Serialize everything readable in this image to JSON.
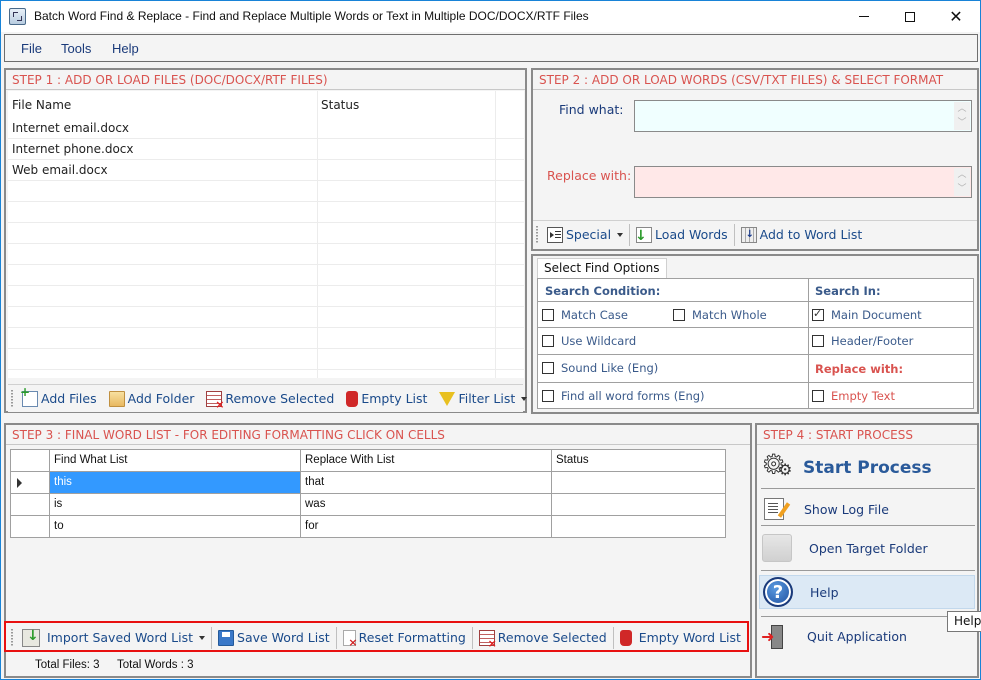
{
  "window": {
    "title": "Batch Word Find & Replace - Find and Replace Multiple Words or Text  in Multiple DOC/DOCX/RTF Files",
    "minimize": "minimize",
    "maximize": "maximize",
    "close": "✕"
  },
  "menu": {
    "items": [
      {
        "label": "File"
      },
      {
        "label": "Tools"
      },
      {
        "label": "Help"
      }
    ]
  },
  "step1": {
    "header": "STEP 1 : ADD OR LOAD FILES (DOC/DOCX/RTF FILES)",
    "columns": [
      "File Name",
      "Status"
    ],
    "files": [
      {
        "name": "Internet email.docx",
        "status": ""
      },
      {
        "name": "Internet phone.docx",
        "status": ""
      },
      {
        "name": "Web email.docx",
        "status": ""
      }
    ],
    "toolbar": {
      "add_files": "Add Files",
      "add_folder": "Add Folder",
      "remove_selected": "Remove Selected",
      "empty_list": "Empty List",
      "filter_list": "Filter List"
    }
  },
  "step2": {
    "header": "STEP 2 : ADD OR LOAD WORDS (CSV/TXT FILES) & SELECT FORMAT",
    "find_label": "Find what:",
    "find_value": "",
    "replace_label": "Replace with:",
    "replace_value": "",
    "toolbar": {
      "special": "Special",
      "load_words": "Load Words",
      "add_to_word_list": "Add to Word List"
    }
  },
  "find_options": {
    "tab": "Select Find Options",
    "search_condition_label": "Search Condition:",
    "search_in_label": "Search In:",
    "replace_with_label": "Replace with:",
    "options": {
      "match_case": {
        "label": "Match Case",
        "checked": false
      },
      "match_whole": {
        "label": "Match Whole",
        "checked": false
      },
      "use_wildcard": {
        "label": "Use Wildcard",
        "checked": false
      },
      "sound_like": {
        "label": "Sound Like (Eng)",
        "checked": false
      },
      "find_all_forms": {
        "label": "Find all word forms (Eng)",
        "checked": false
      },
      "main_document": {
        "label": "Main Document",
        "checked": true
      },
      "header_footer": {
        "label": "Header/Footer",
        "checked": false
      },
      "empty_text": {
        "label": "Empty Text",
        "checked": false
      }
    }
  },
  "step3": {
    "header": "STEP 3 : FINAL WORD LIST - FOR EDITING FORMATTING CLICK ON CELLS",
    "columns": [
      "Find What List",
      "Replace With List",
      "Status"
    ],
    "rows": [
      {
        "find": "this",
        "replace": "that",
        "status": ""
      },
      {
        "find": "is",
        "replace": "was",
        "status": ""
      },
      {
        "find": "to",
        "replace": "for",
        "status": ""
      }
    ],
    "toolbar": {
      "import_saved": "Import Saved Word List",
      "save_word_list": "Save Word List",
      "reset_formatting": "Reset Formatting",
      "remove_selected": "Remove Selected",
      "empty_word_list": "Empty Word List"
    },
    "status": {
      "total_files": "Total Files: 3",
      "total_words": "Total Words : 3"
    }
  },
  "step4": {
    "header": "STEP 4 : START PROCESS",
    "start_process": "Start Process",
    "show_log": "Show Log File",
    "open_target": "Open Target Folder",
    "help": "Help",
    "quit": "Quit Application",
    "tooltip": "Help"
  },
  "colors": {
    "accent_red": "#d9534f",
    "link_blue": "#1a3a7a",
    "selection": "#3399ff",
    "find_bg": "#f0ffff",
    "replace_bg": "#ffe8e8",
    "highlight_border": "#e81010"
  }
}
